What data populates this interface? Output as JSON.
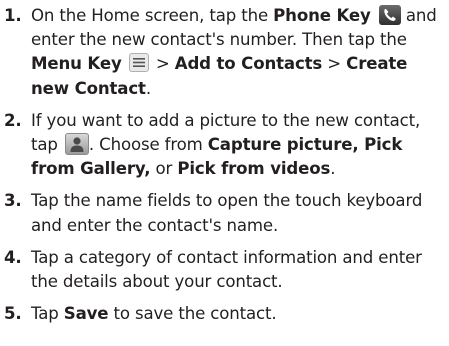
{
  "steps": [
    {
      "number": "1.",
      "p1": "On the Home screen, tap the ",
      "phone_key": "Phone Key",
      "p2": " and enter the new contact's number. Then tap the ",
      "menu_key": "Menu Key",
      "p3": " > ",
      "add_to_contacts": "Add to Contacts",
      "p4": " > ",
      "create_new_contact": "Create new Contact",
      "p5": "."
    },
    {
      "number": "2.",
      "p1": "If you want to add a picture to the new contact, tap ",
      "p2": ". Choose from ",
      "capture": "Capture picture, Pick from Gallery,",
      "p3": " or ",
      "videos": "Pick from videos",
      "p4": "."
    },
    {
      "number": "3.",
      "text": "Tap the name fields to open the touch keyboard and enter the contact's name."
    },
    {
      "number": "4.",
      "text": "Tap a category of contact information and enter the details about your contact."
    },
    {
      "number": "5.",
      "p1": "Tap ",
      "save": "Save",
      "p2": " to save the contact."
    }
  ],
  "icons": {
    "phone_key": "phone-icon",
    "menu_key": "menu-icon",
    "contact_picture": "contact-picture-icon"
  }
}
